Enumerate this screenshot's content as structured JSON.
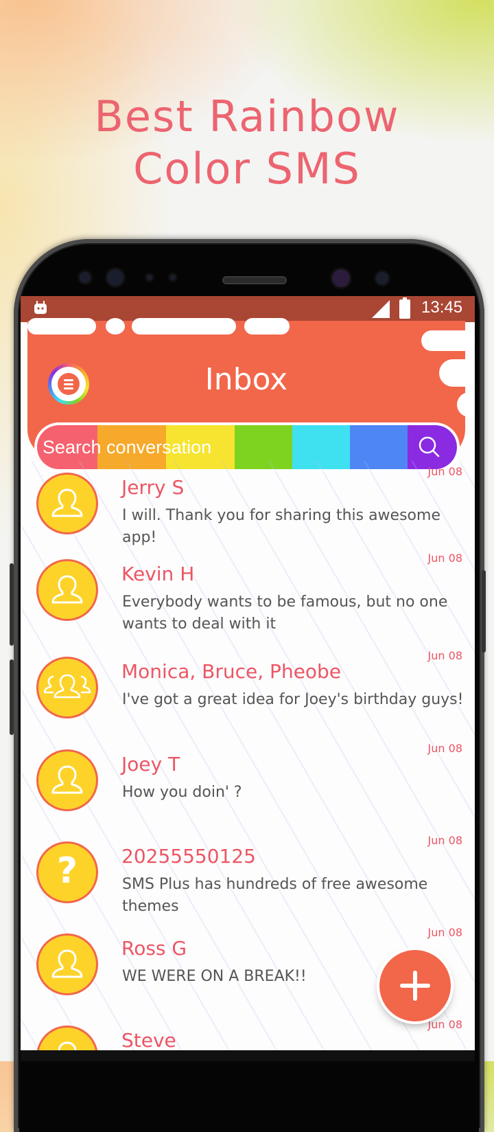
{
  "promo": {
    "line1": "Best Rainbow",
    "line2": "Color SMS"
  },
  "status_bar": {
    "time": "13:45"
  },
  "header": {
    "title": "Inbox"
  },
  "search": {
    "placeholder": "Search conversation"
  },
  "colors": {
    "accent": "#f2664a",
    "status_bar": "#a94634",
    "name_text": "#ec5564",
    "avatar_fill": "#fdd32a",
    "rainbow": [
      "#f5616e",
      "#f6a92a",
      "#f6e430",
      "#7ed321",
      "#3fe1f0",
      "#4f86f5",
      "#8a2be2"
    ]
  },
  "conversations": [
    {
      "name": "Jerry S",
      "preview": "I will. Thank you for sharing this awesome app!",
      "date": "Jun 08",
      "avatar": "person-icon"
    },
    {
      "name": "Kevin H",
      "preview": "Everybody wants to be famous, but no one wants to deal with it",
      "date": "Jun 08",
      "avatar": "person-icon"
    },
    {
      "name": "Monica, Bruce, Pheobe",
      "preview": "I've got a great idea for Joey's birthday guys!",
      "date": "Jun 08",
      "avatar": "group-icon"
    },
    {
      "name": "Joey T",
      "preview": "How you doin' ?",
      "date": "Jun 08",
      "avatar": "person-icon"
    },
    {
      "name": "20255550125",
      "preview": "SMS Plus has hundreds of free awesome themes",
      "date": "Jun 08",
      "avatar": "unknown-contact-icon",
      "avatar_text": "?"
    },
    {
      "name": "Ross G",
      "preview": "WE WERE ON A BREAK!!",
      "date": "Jun 08",
      "avatar": "person-icon"
    },
    {
      "name": "Steve",
      "preview": "",
      "date": "Jun 08",
      "avatar": "person-icon"
    }
  ]
}
